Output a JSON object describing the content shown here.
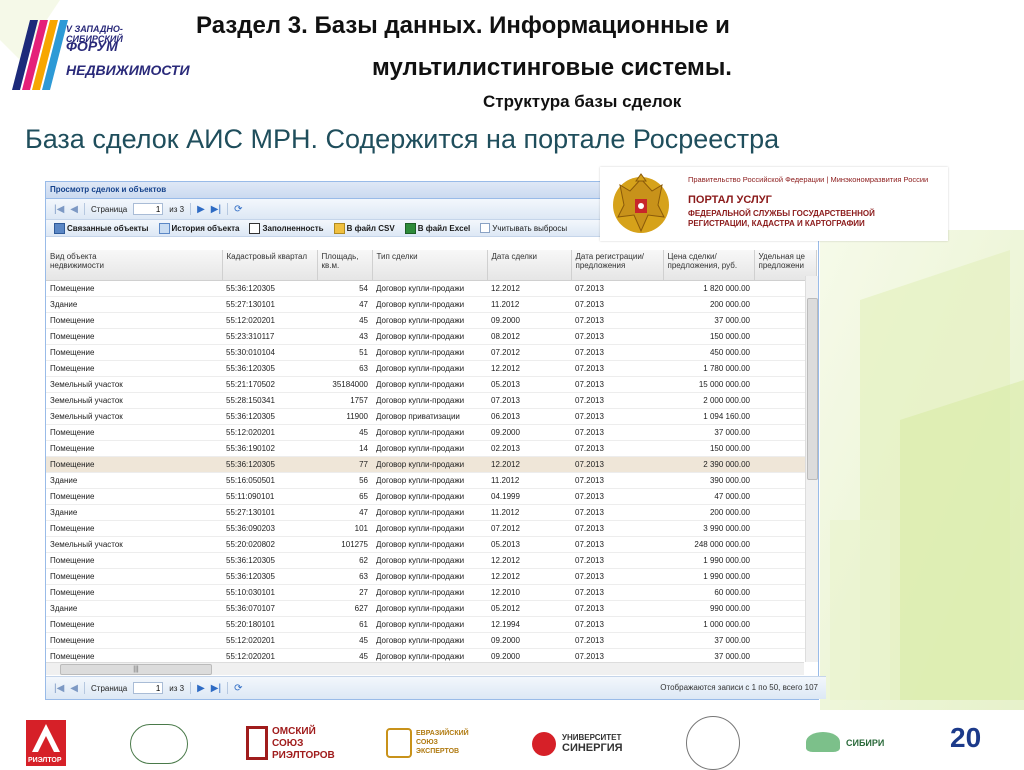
{
  "forum_logo": {
    "line1": "V ЗАПАДНО-СИБИРСКИЙ",
    "line2": "ФОРУМ",
    "line3": "НЕДВИЖИМОСТИ"
  },
  "heading": {
    "line1": "Раздел 3. Базы данных. Информационные и",
    "line2": "мультилистинговые системы.",
    "line3": "Структура базы сделок"
  },
  "subheading": "База сделок АИС МРН. Содержится на портале Росреестра",
  "window": {
    "title": "Просмотр сделок и объектов",
    "pager": {
      "page_label": "Страница",
      "page_value": "1",
      "of_label": "из 3"
    },
    "toolbar": {
      "linked": "Связанные объекты",
      "history": "История объекта",
      "fill": "Заполненность",
      "csv": "В файл CSV",
      "excel": "В файл Excel",
      "outliers": "Учитывать выбросы"
    },
    "columns": [
      "Вид объекта\nнедвижимости",
      "Кадастровый квартал",
      "Площадь,\nкв.м.",
      "Тип сделки",
      "Дата сделки",
      "Дата регистрации/\nпредложения",
      "Цена сделки/\nпредложения, руб.",
      "Удельная це\nпредложени"
    ],
    "rows": [
      [
        "Помещение",
        "55:36:120305",
        "54",
        "Договор купли-продажи",
        "12.2012",
        "07.2013",
        "1 820 000.00"
      ],
      [
        "Здание",
        "55:27:130101",
        "47",
        "Договор купли-продажи",
        "11.2012",
        "07.2013",
        "200 000.00"
      ],
      [
        "Помещение",
        "55:12:020201",
        "45",
        "Договор купли-продажи",
        "09.2000",
        "07.2013",
        "37 000.00"
      ],
      [
        "Помещение",
        "55:23:310117",
        "43",
        "Договор купли-продажи",
        "08.2012",
        "07.2013",
        "150 000.00"
      ],
      [
        "Помещение",
        "55:30:010104",
        "51",
        "Договор купли-продажи",
        "07.2012",
        "07.2013",
        "450 000.00"
      ],
      [
        "Помещение",
        "55:36:120305",
        "63",
        "Договор купли-продажи",
        "12.2012",
        "07.2013",
        "1 780 000.00"
      ],
      [
        "Земельный участок",
        "55:21:170502",
        "35184000",
        "Договор купли-продажи",
        "05.2013",
        "07.2013",
        "15 000 000.00"
      ],
      [
        "Земельный участок",
        "55:28:150341",
        "1757",
        "Договор купли-продажи",
        "07.2013",
        "07.2013",
        "2 000 000.00"
      ],
      [
        "Земельный участок",
        "55:36:120305",
        "11900",
        "Договор приватизации",
        "06.2013",
        "07.2013",
        "1 094 160.00"
      ],
      [
        "Помещение",
        "55:12:020201",
        "45",
        "Договор купли-продажи",
        "09.2000",
        "07.2013",
        "37 000.00"
      ],
      [
        "Помещение",
        "55:36:190102",
        "14",
        "Договор купли-продажи",
        "02.2013",
        "07.2013",
        "150 000.00"
      ],
      [
        "Помещение",
        "55:36:120305",
        "77",
        "Договор купли-продажи",
        "12.2012",
        "07.2013",
        "2 390 000.00"
      ],
      [
        "Здание",
        "55:16:050501",
        "56",
        "Договор купли-продажи",
        "11.2012",
        "07.2013",
        "390 000.00"
      ],
      [
        "Помещение",
        "55:11:090101",
        "65",
        "Договор купли-продажи",
        "04.1999",
        "07.2013",
        "47 000.00"
      ],
      [
        "Здание",
        "55:27:130101",
        "47",
        "Договор купли-продажи",
        "11.2012",
        "07.2013",
        "200 000.00"
      ],
      [
        "Помещение",
        "55:36:090203",
        "101",
        "Договор купли-продажи",
        "07.2012",
        "07.2013",
        "3 990 000.00"
      ],
      [
        "Земельный участок",
        "55:20:020802",
        "101275",
        "Договор купли-продажи",
        "05.2013",
        "07.2013",
        "248 000 000.00"
      ],
      [
        "Помещение",
        "55:36:120305",
        "62",
        "Договор купли-продажи",
        "12.2012",
        "07.2013",
        "1 990 000.00"
      ],
      [
        "Помещение",
        "55:36:120305",
        "63",
        "Договор купли-продажи",
        "12.2012",
        "07.2013",
        "1 990 000.00"
      ],
      [
        "Помещение",
        "55:10:030101",
        "27",
        "Договор купли-продажи",
        "12.2010",
        "07.2013",
        "60 000.00"
      ],
      [
        "Здание",
        "55:36:070107",
        "627",
        "Договор купли-продажи",
        "05.2012",
        "07.2013",
        "990 000.00"
      ],
      [
        "Помещение",
        "55:20:180101",
        "61",
        "Договор купли-продажи",
        "12.1994",
        "07.2013",
        "1 000 000.00"
      ],
      [
        "Помещение",
        "55:12:020201",
        "45",
        "Договор купли-продажи",
        "09.2000",
        "07.2013",
        "37 000.00"
      ],
      [
        "Помещение",
        "55:12:020201",
        "45",
        "Договор купли-продажи",
        "09.2000",
        "07.2013",
        "37 000.00"
      ]
    ],
    "selected_row_index": 11,
    "status": "Отображаются записи с 1 по 50, всего 107"
  },
  "portal": {
    "line1": "Правительство Российской Федерации | Минэкономразвития России",
    "line2": "ПОРТАЛ УСЛУГ",
    "line3": "ФЕДЕРАЛЬНОЙ СЛУЖБЫ ГОСУДАРСТВЕННОЙ",
    "line4": "РЕГИСТРАЦИИ, КАДАСТРА И КАРТОГРАФИИ"
  },
  "footer_logos": {
    "rieltor": "РИЭЛТОР",
    "omsk1": "ОМСКИЙ",
    "omsk2": "СОЮЗ",
    "omsk3": "РИЭЛТОРОВ",
    "eur1": "ЕВРАЗИЙСКИЙ",
    "eur2": "СОЮЗ",
    "eur3": "ЭКСПЕРТОВ",
    "syn1": "УНИВЕРСИТЕТ",
    "syn2": "СИНЕРГИЯ",
    "sibiri": "СИБИРИ",
    "twenty": "20"
  },
  "colors": {
    "heading": "#111111",
    "subheading": "#1f4e5c",
    "grid_border": "#99bbe8",
    "selected_row": "#efe6d8",
    "portal_red": "#8b1a1a"
  }
}
